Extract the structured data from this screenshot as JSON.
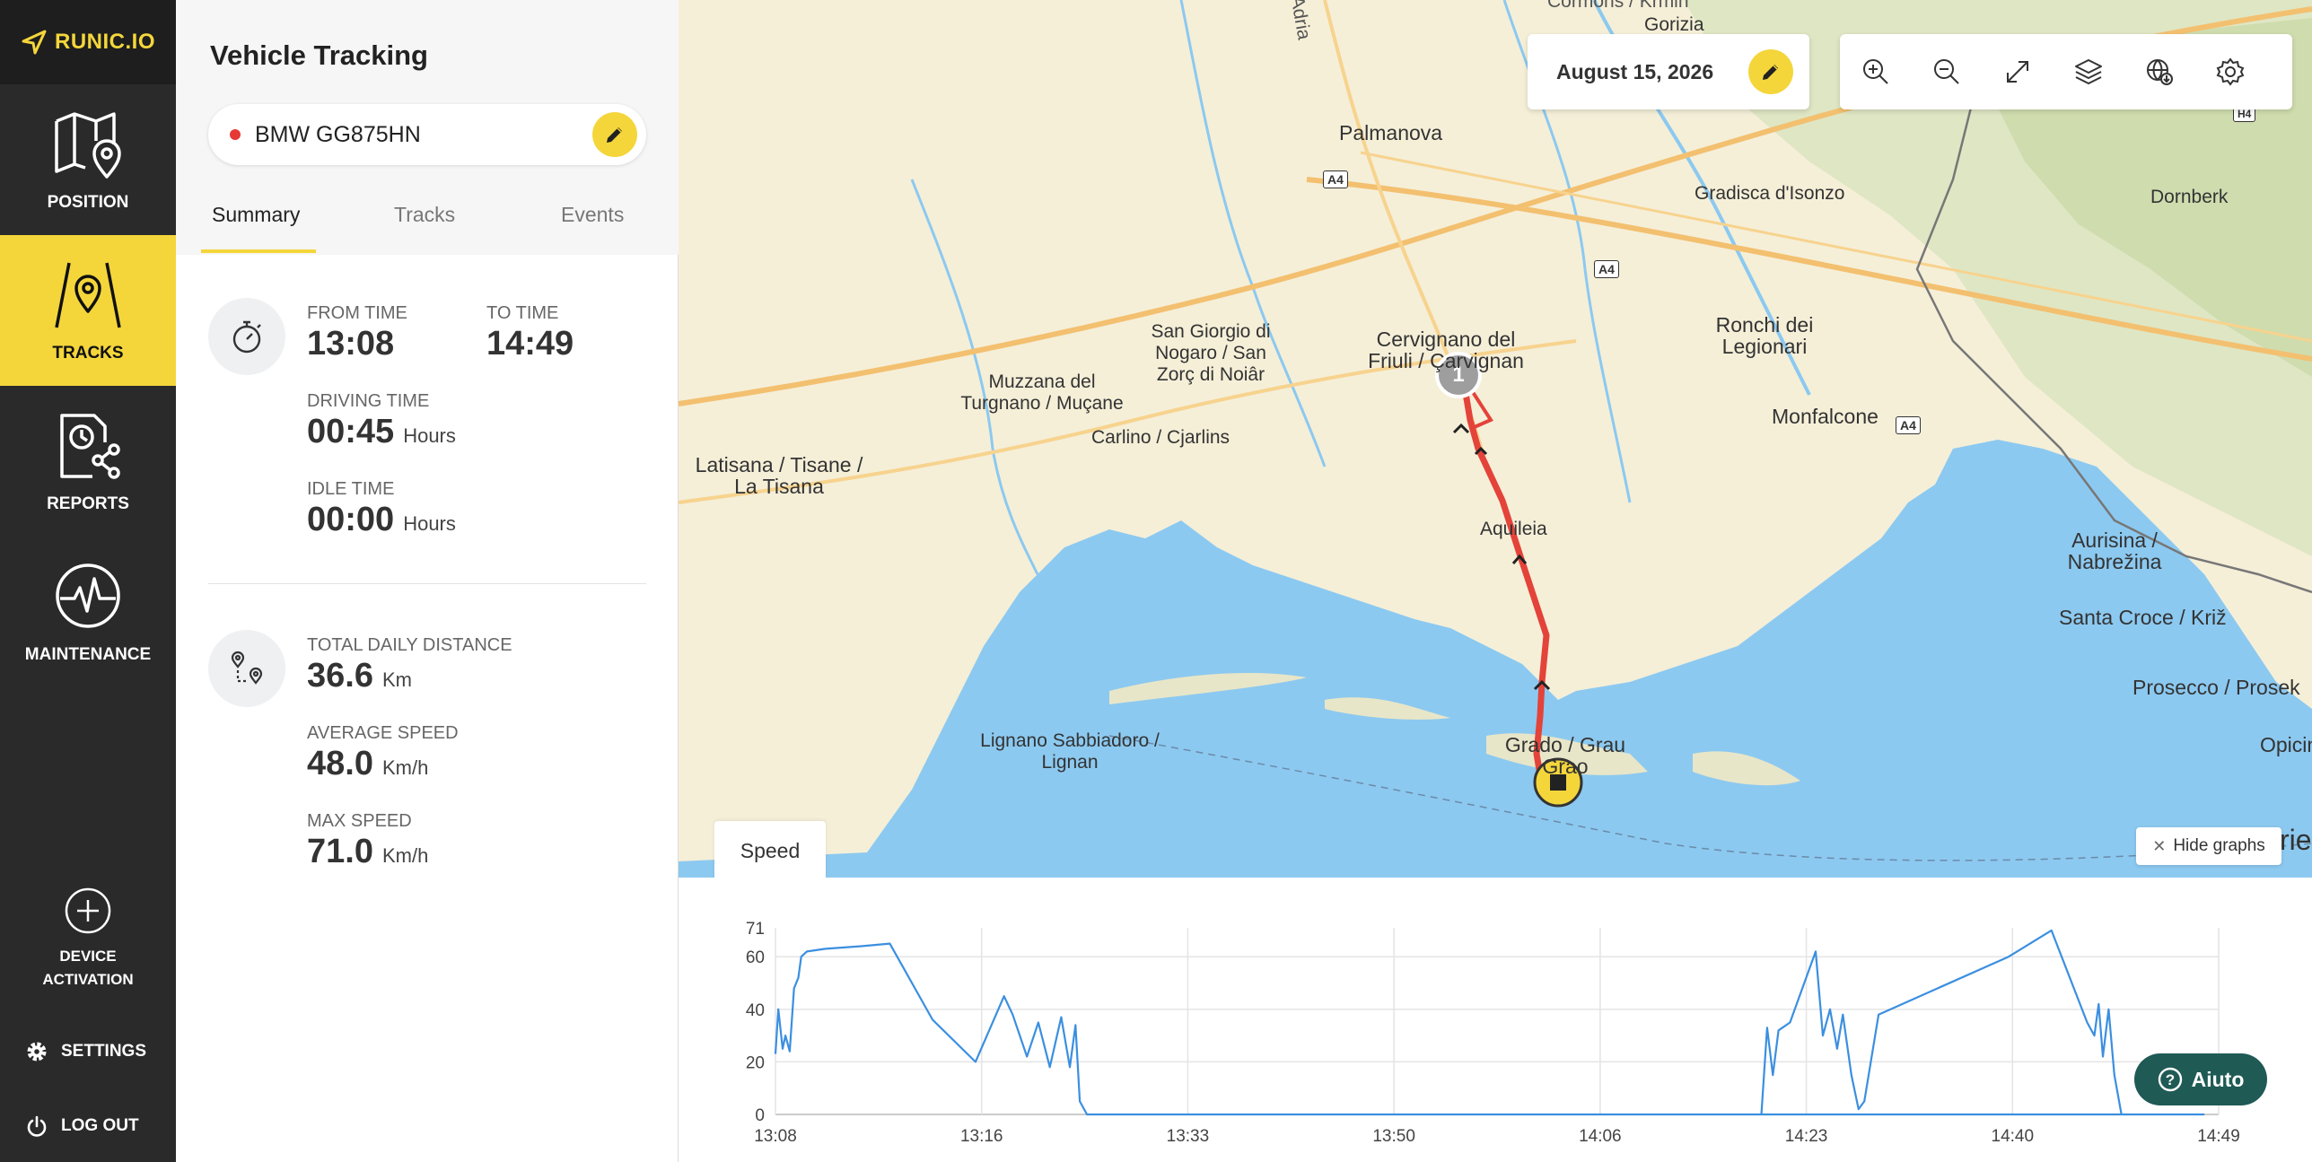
{
  "app": {
    "logo_text": "RUNIC.IO"
  },
  "sidebar": {
    "items": [
      {
        "label": "POSITION"
      },
      {
        "label": "TRACKS"
      },
      {
        "label": "REPORTS"
      },
      {
        "label": "MAINTENANCE"
      },
      {
        "label": "DEVICE ACTIVATION"
      }
    ],
    "settings_label": "SETTINGS",
    "logout_label": "LOG OUT"
  },
  "panel": {
    "title": "Vehicle Tracking",
    "vehicle": "BMW GG875HN",
    "tabs": [
      "Summary",
      "Tracks",
      "Events"
    ],
    "summary": {
      "from_time_label": "FROM TIME",
      "from_time": "13:08",
      "to_time_label": "TO TIME",
      "to_time": "14:49",
      "driving_time_label": "DRIVING TIME",
      "driving_time": "00:45",
      "idle_time_label": "IDLE TIME",
      "idle_time": "00:00",
      "hours_unit": "Hours",
      "distance_label": "TOTAL DAILY DISTANCE",
      "distance": "36.6",
      "distance_unit": "Km",
      "avg_speed_label": "AVERAGE SPEED",
      "avg_speed": "48.0",
      "max_speed_label": "MAX SPEED",
      "max_speed": "71.0",
      "speed_unit": "Km/h"
    }
  },
  "map": {
    "date": "August 15, 2026",
    "labels": {
      "palmanova": "Palmanova",
      "gorizia": "Gorizia",
      "cormons": "Cormons / Krmin",
      "gradisca": "Gradisca d'Isonzo",
      "dornberk": "Dornberk",
      "cervignano": "Cervignano del Friuli / Çarvignan",
      "sangiorgio": "San Giorgio di Nogaro / San Zorç di Noiâr",
      "muzzana": "Muzzana del Turgnano / Muçane",
      "carlino": "Carlino / Cjarlins",
      "latisana": "Latisana / Tisane / La Tisana",
      "ronchi": "Ronchi dei Legionari",
      "monfalcone": "Monfalcone",
      "aquileia": "Aquileia",
      "aurisina": "Aurisina / Nabrežina",
      "santacroce": "Santa Croce / Križ",
      "prosecco": "Prosecco / Prosek",
      "opicina": "Opicina",
      "lignano": "Lignano Sabbiadoro / Lignan",
      "grado": "Grado / Grau Grao",
      "adria": "Adria",
      "a4": "A4",
      "h4": "H4",
      "trieste_partial": "rie"
    },
    "start_marker": "1",
    "speed_tab": "Speed",
    "hide_graphs": "Hide graphs"
  },
  "chart_data": {
    "type": "line",
    "title": "",
    "xlabel": "",
    "ylabel": "",
    "x_ticks": [
      "13:08",
      "13:16",
      "13:33",
      "13:50",
      "14:06",
      "14:23",
      "14:40",
      "14:49"
    ],
    "y_ticks": [
      0,
      20,
      40,
      60,
      71
    ],
    "ylim": [
      0,
      71
    ],
    "xlim": [
      0,
      101
    ],
    "grid": true,
    "color": "#3b8fe0",
    "series": [
      {
        "x": [
          0,
          0.2,
          0.5,
          0.7,
          1.0,
          1.3,
          1.6,
          1.8,
          2.2,
          3.5,
          6,
          8,
          11,
          14,
          16,
          16.6,
          17.6,
          18.4,
          19.2,
          20,
          20.6,
          21,
          21.3,
          21.8,
          22.5,
          100,
          69,
          69.4,
          69.8,
          70.2,
          71,
          72.8,
          73.3,
          73.8,
          74.3,
          74.7,
          75.3,
          75.8,
          76.2,
          77.2,
          86.3,
          89.3,
          91.8,
          92.3,
          92.6,
          92.9,
          93.3,
          93.7,
          94.2
        ],
        "y": [
          23,
          40,
          25,
          30,
          24,
          48,
          52,
          60,
          62,
          63,
          64,
          65,
          36,
          20,
          45,
          38,
          22,
          35,
          18,
          37,
          18,
          34,
          5,
          0,
          0,
          0,
          0,
          33,
          15,
          32,
          35,
          62,
          30,
          40,
          25,
          38,
          15,
          2,
          5,
          38,
          60,
          70,
          35,
          30,
          42,
          22,
          40,
          15,
          0
        ]
      }
    ]
  }
}
